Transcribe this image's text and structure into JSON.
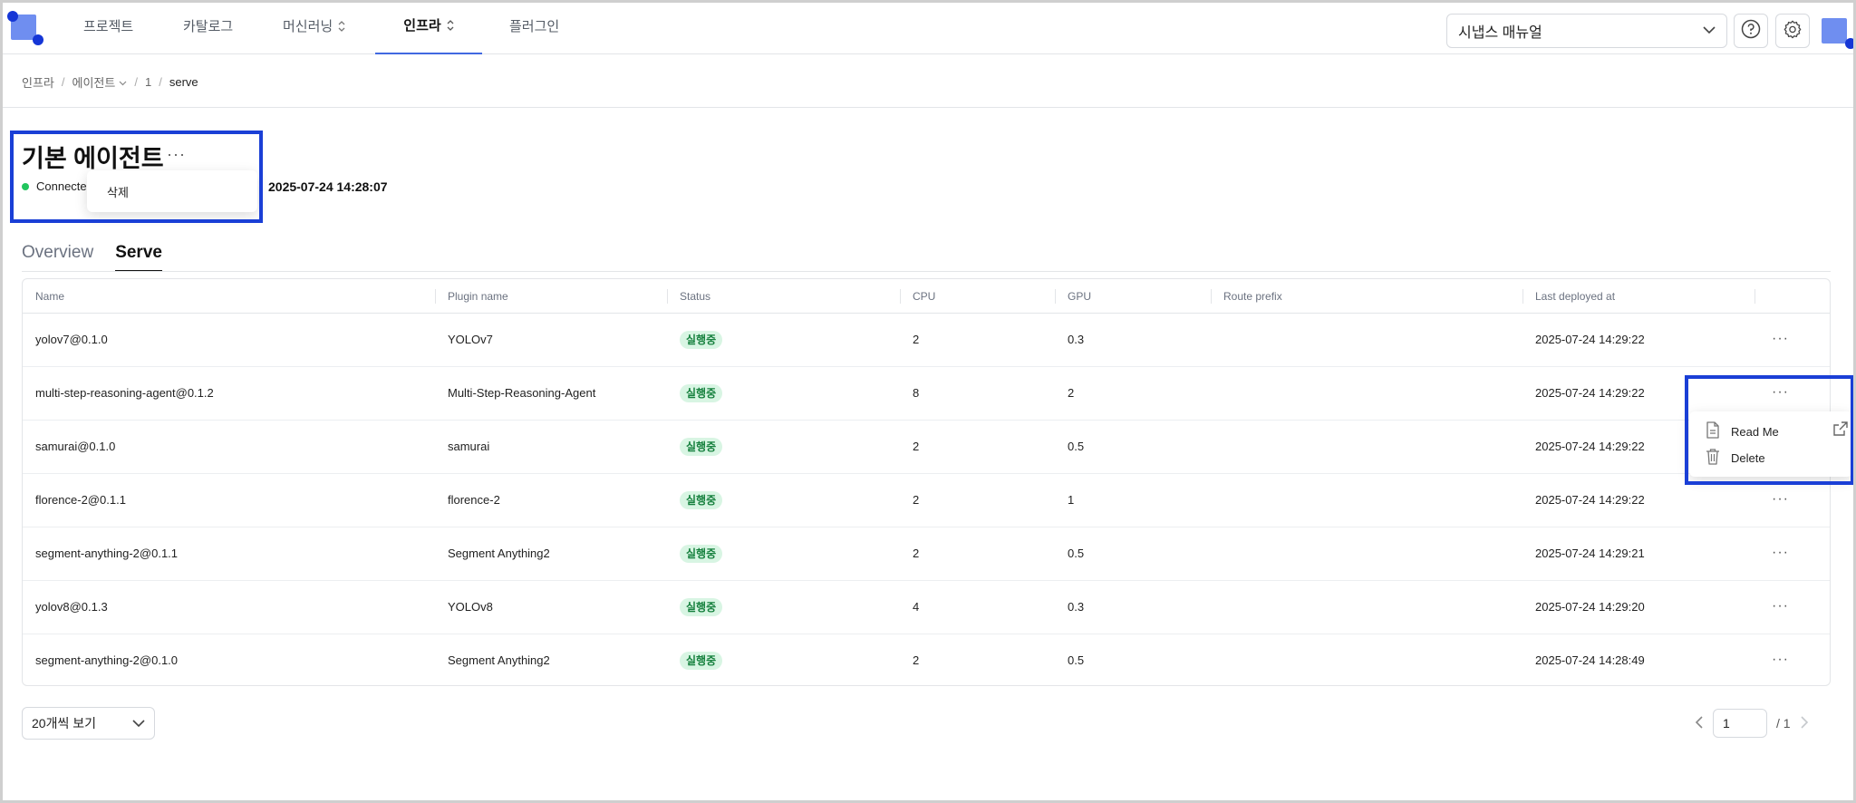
{
  "nav": {
    "items": [
      {
        "label": "프로젝트",
        "has_toggle": false
      },
      {
        "label": "카탈로그",
        "has_toggle": false
      },
      {
        "label": "머신러닝",
        "has_toggle": true
      },
      {
        "label": "인프라",
        "has_toggle": true,
        "active": true
      },
      {
        "label": "플러그인",
        "has_toggle": false
      }
    ],
    "manual_select": "시냅스 매뉴얼"
  },
  "breadcrumb": [
    "인프라",
    "에이전트",
    "1",
    "serve"
  ],
  "agent": {
    "title": "기본 에이전트",
    "status": "Connected",
    "last_time": "2025-07-24 14:28:07",
    "menu_delete": "삭제"
  },
  "tabs": [
    "Overview",
    "Serve"
  ],
  "table": {
    "headers": [
      "Name",
      "Plugin name",
      "Status",
      "CPU",
      "GPU",
      "Route prefix",
      "Last deployed at"
    ],
    "rows": [
      {
        "name": "yolov7@0.1.0",
        "plugin": "YOLOv7",
        "status": "실행중",
        "cpu": "2",
        "gpu": "0.3",
        "route": "",
        "deployed": "2025-07-24 14:29:22"
      },
      {
        "name": "multi-step-reasoning-agent@0.1.2",
        "plugin": "Multi-Step-Reasoning-Agent",
        "status": "실행중",
        "cpu": "8",
        "gpu": "2",
        "route": "",
        "deployed": "2025-07-24 14:29:22"
      },
      {
        "name": "samurai@0.1.0",
        "plugin": "samurai",
        "status": "실행중",
        "cpu": "2",
        "gpu": "0.5",
        "route": "",
        "deployed": "2025-07-24 14:29:22"
      },
      {
        "name": "florence-2@0.1.1",
        "plugin": "florence-2",
        "status": "실행중",
        "cpu": "2",
        "gpu": "1",
        "route": "",
        "deployed": "2025-07-24 14:29:22"
      },
      {
        "name": "segment-anything-2@0.1.1",
        "plugin": "Segment Anything2",
        "status": "실행중",
        "cpu": "2",
        "gpu": "0.5",
        "route": "",
        "deployed": "2025-07-24 14:29:21"
      },
      {
        "name": "yolov8@0.1.3",
        "plugin": "YOLOv8",
        "status": "실행중",
        "cpu": "4",
        "gpu": "0.3",
        "route": "",
        "deployed": "2025-07-24 14:29:20"
      },
      {
        "name": "segment-anything-2@0.1.0",
        "plugin": "Segment Anything2",
        "status": "실행중",
        "cpu": "2",
        "gpu": "0.5",
        "route": "",
        "deployed": "2025-07-24 14:28:49"
      }
    ],
    "more_glyph": "···"
  },
  "row_menu": {
    "open_row": 1,
    "read_me": "Read Me",
    "delete": "Delete"
  },
  "footer": {
    "page_size": "20개씩 보기",
    "page": "1",
    "total": "/ 1"
  },
  "colors": {
    "accent": "#4169e1",
    "highlight": "#1a3fd6",
    "status_bg": "#d8f5e3",
    "status_fg": "#15803d",
    "connected": "#22c55e"
  },
  "icons": {
    "logo": "logo-icon",
    "help": "help-icon",
    "settings": "gear-icon",
    "read_me": "document-icon",
    "delete": "trash-icon",
    "external": "external-link-icon"
  }
}
